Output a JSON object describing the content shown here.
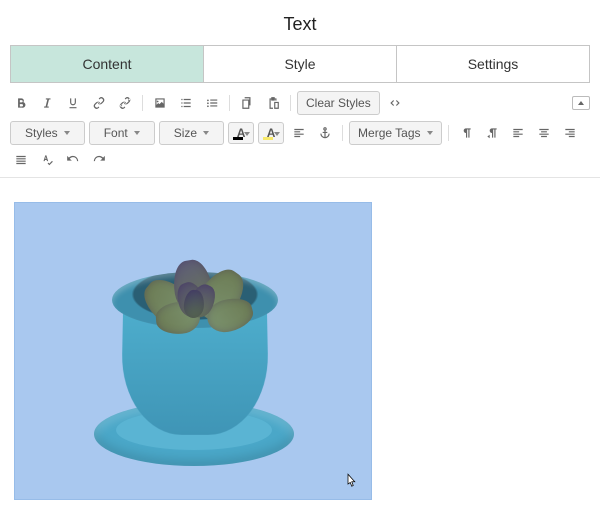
{
  "title": "Text",
  "tabs": [
    {
      "label": "Content",
      "active": true
    },
    {
      "label": "Style",
      "active": false
    },
    {
      "label": "Settings",
      "active": false
    }
  ],
  "toolbar": {
    "clear_styles": "Clear Styles",
    "styles": "Styles",
    "font": "Font",
    "size": "Size",
    "merge_tags": "Merge Tags"
  }
}
